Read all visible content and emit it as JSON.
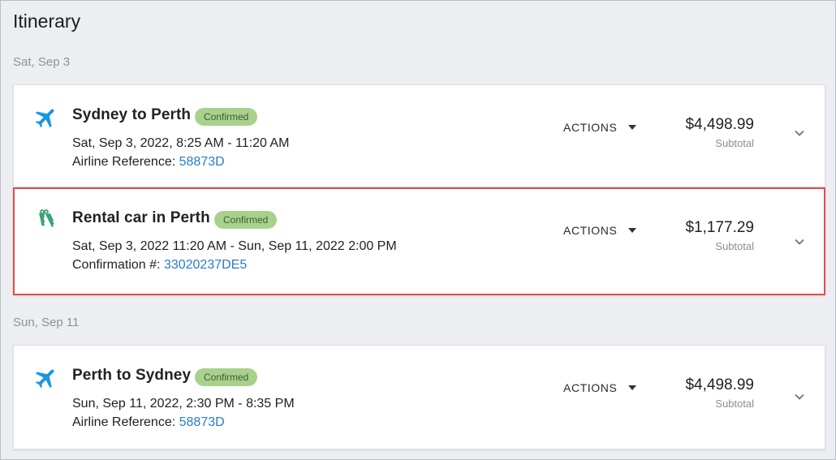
{
  "page": {
    "title": "Itinerary"
  },
  "groups": [
    {
      "date": "Sat, Sep 3"
    },
    {
      "date": "Sun, Sep 11"
    }
  ],
  "items": [
    {
      "icon": "airplane-icon",
      "title": "Sydney to Perth",
      "status": "Confirmed",
      "time": "Sat, Sep 3, 2022, 8:25 AM - 11:20 AM",
      "ref_label": "Airline Reference: ",
      "ref_value": "58873D",
      "actions_label": "ACTIONS",
      "price": "$4,498.99",
      "price_label": "Subtotal"
    },
    {
      "icon": "car-keys-icon",
      "title": "Rental car in Perth",
      "status": "Confirmed",
      "time": "Sat, Sep 3, 2022 11:20 AM - Sun, Sep 11, 2022 2:00 PM",
      "ref_label": "Confirmation #: ",
      "ref_value": "33020237DE5",
      "actions_label": "ACTIONS",
      "price": "$1,177.29",
      "price_label": "Subtotal"
    },
    {
      "icon": "airplane-icon",
      "title": "Perth to Sydney",
      "status": "Confirmed",
      "time": "Sun, Sep 11, 2022, 2:30 PM - 8:35 PM",
      "ref_label": "Airline Reference: ",
      "ref_value": "58873D",
      "actions_label": "ACTIONS",
      "price": "$4,498.99",
      "price_label": "Subtotal"
    }
  ],
  "colors": {
    "plane_icon": "#1a96df",
    "keys_icon": "#3aa377",
    "badge_bg": "#a9d18e",
    "link": "#2a7cc8",
    "selected_border": "#e34b4b"
  }
}
